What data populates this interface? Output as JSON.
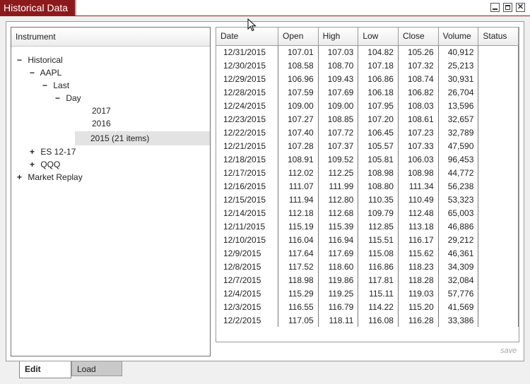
{
  "window": {
    "title": "Historical Data",
    "close_glyph": "✕"
  },
  "left_panel": {
    "header": "Instrument"
  },
  "tree": [
    {
      "label": "Historical",
      "toggle": "−",
      "level": 0
    },
    {
      "label": "AAPL",
      "toggle": "−",
      "level": 1
    },
    {
      "label": "Last",
      "toggle": "−",
      "level": 2
    },
    {
      "label": "Day",
      "toggle": "−",
      "level": 3
    },
    {
      "label": "2017",
      "toggle": "",
      "level": 4
    },
    {
      "label": "2016",
      "toggle": "",
      "level": 4
    },
    {
      "label": "2015 (21 items)",
      "toggle": "",
      "level": 4,
      "selected": true
    },
    {
      "label": "ES 12-17",
      "toggle": "+",
      "level": 1
    },
    {
      "label": "QQQ",
      "toggle": "+",
      "level": 1
    },
    {
      "label": "Market Replay",
      "toggle": "+",
      "level": 0
    }
  ],
  "table": {
    "columns": [
      "Date",
      "Open",
      "High",
      "Low",
      "Close",
      "Volume",
      "Status"
    ],
    "rows": [
      [
        "12/31/2015",
        "107.01",
        "107.03",
        "104.82",
        "105.26",
        "40,912",
        ""
      ],
      [
        "12/30/2015",
        "108.58",
        "108.70",
        "107.18",
        "107.32",
        "25,213",
        ""
      ],
      [
        "12/29/2015",
        "106.96",
        "109.43",
        "106.86",
        "108.74",
        "30,931",
        ""
      ],
      [
        "12/28/2015",
        "107.59",
        "107.69",
        "106.18",
        "106.82",
        "26,704",
        ""
      ],
      [
        "12/24/2015",
        "109.00",
        "109.00",
        "107.95",
        "108.03",
        "13,596",
        ""
      ],
      [
        "12/23/2015",
        "107.27",
        "108.85",
        "107.20",
        "108.61",
        "32,657",
        ""
      ],
      [
        "12/22/2015",
        "107.40",
        "107.72",
        "106.45",
        "107.23",
        "32,789",
        ""
      ],
      [
        "12/21/2015",
        "107.28",
        "107.37",
        "105.57",
        "107.33",
        "47,590",
        ""
      ],
      [
        "12/18/2015",
        "108.91",
        "109.52",
        "105.81",
        "106.03",
        "96,453",
        ""
      ],
      [
        "12/17/2015",
        "112.02",
        "112.25",
        "108.98",
        "108.98",
        "44,772",
        ""
      ],
      [
        "12/16/2015",
        "111.07",
        "111.99",
        "108.80",
        "111.34",
        "56,238",
        ""
      ],
      [
        "12/15/2015",
        "111.94",
        "112.80",
        "110.35",
        "110.49",
        "53,323",
        ""
      ],
      [
        "12/14/2015",
        "112.18",
        "112.68",
        "109.79",
        "112.48",
        "65,003",
        ""
      ],
      [
        "12/11/2015",
        "115.19",
        "115.39",
        "112.85",
        "113.18",
        "46,886",
        ""
      ],
      [
        "12/10/2015",
        "116.04",
        "116.94",
        "115.51",
        "116.17",
        "29,212",
        ""
      ],
      [
        "12/9/2015",
        "117.64",
        "117.69",
        "115.08",
        "115.62",
        "46,361",
        ""
      ],
      [
        "12/8/2015",
        "117.52",
        "118.60",
        "116.86",
        "118.23",
        "34,309",
        ""
      ],
      [
        "12/7/2015",
        "118.98",
        "119.86",
        "117.81",
        "118.28",
        "32,084",
        ""
      ],
      [
        "12/4/2015",
        "115.29",
        "119.25",
        "115.11",
        "119.03",
        "57,776",
        ""
      ],
      [
        "12/3/2015",
        "116.55",
        "116.79",
        "114.22",
        "115.20",
        "41,569",
        ""
      ],
      [
        "12/2/2015",
        "117.05",
        "118.11",
        "116.08",
        "116.28",
        "33,386",
        ""
      ]
    ]
  },
  "footer": {
    "save_label": "save"
  },
  "tabs": [
    {
      "label": "Edit",
      "active": true
    },
    {
      "label": "Load",
      "active": false
    }
  ],
  "colors": {
    "accent": "#8c1a1d",
    "selection": "#e3e3e3"
  }
}
